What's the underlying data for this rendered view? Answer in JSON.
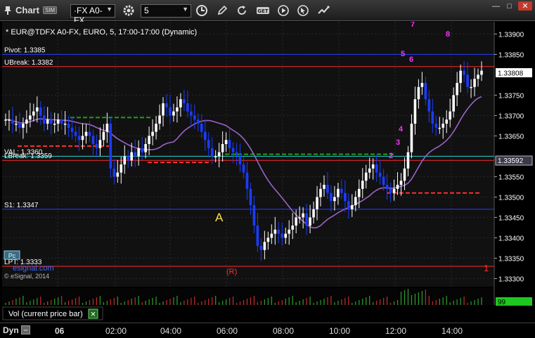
{
  "toolbar": {
    "app_name": "Chart",
    "sim_badge": "SIM",
    "symbol": "·FX A0-FX",
    "interval": "5",
    "icons": [
      "pin-icon",
      "settings-gear-icon",
      "clock-icon",
      "pencil-draw-icon",
      "refresh-icon",
      "get-data-icon",
      "play-icon",
      "cursor-icon",
      "chart-options-icon"
    ]
  },
  "window": {
    "minimize": "—",
    "maximize": "□",
    "close": "✕"
  },
  "chart": {
    "header": "* EUR@TDFX A0-FX, EURO, 5, 17:00-17:00 (Dynamic)",
    "watermark": "© eSignal, 2014",
    "vendor_logo": "esignal.com",
    "indicator_panel_title": "Vol (current price bar)",
    "volume_value": "99",
    "price_axis_labels": [
      "1.33900",
      "1.33850",
      "1.33750",
      "1.33700",
      "1.33650",
      "1.33550",
      "1.33500",
      "1.33450",
      "1.33400",
      "1.33350",
      "1.33300"
    ],
    "current_price": "1.33808",
    "secondary_price_badge": "1.33592",
    "time_labels": [
      "06",
      "02:00",
      "04:00",
      "06:00",
      "08:00",
      "10:00",
      "12:00",
      "14:00"
    ],
    "pattern_marker": "A",
    "reversal_marker": "(R)",
    "level_marker": "1",
    "level_lines": [
      {
        "label": "Pivot: 1.3385",
        "value": 1.3385,
        "color": "#2a3cff"
      },
      {
        "label": "UBreak: 1.3382",
        "value": 1.3382,
        "color": "#ff2a2a"
      },
      {
        "label": "VAL: 1.3360",
        "value": 1.336,
        "color": "#2ad4d4"
      },
      {
        "label": "LBreak: 1.3359",
        "value": 1.3359,
        "color": "#ff2a2a"
      },
      {
        "label": "S1: 1.3347",
        "value": 1.3347,
        "color": "#2a3cff"
      },
      {
        "label": "LPT: 1.3333",
        "value": 1.3333,
        "color": "#ff2a2a"
      }
    ],
    "sequence_labels": [
      "7",
      "8",
      "5",
      "6",
      "4",
      "3",
      "2"
    ],
    "colors": {
      "up_bar": "#ffffff",
      "down_bar": "#1a3cff",
      "ma": "#9a62c8",
      "volume_up": "#2aa02a",
      "volume_down": "#c82a2a",
      "value_badge": "#1ec81e"
    }
  },
  "chart_data": {
    "type": "bar",
    "title": "EUR@TDFX A0-FX, EURO, 5, 17:00-17:00 (Dynamic)",
    "xlabel": "",
    "ylabel": "",
    "x_range": [
      "00:00",
      "15:30"
    ],
    "ylim": [
      1.3328,
      1.3393
    ],
    "grid": true,
    "series": [
      {
        "values": [
          1.3369,
          1.3369,
          1.3368,
          1.3368,
          1.3367,
          1.3368,
          1.3369,
          1.337,
          1.3371,
          1.3372,
          1.337,
          1.3368,
          1.3369,
          1.3368,
          1.3368,
          1.3369,
          1.3368,
          1.3368,
          1.3367,
          1.3366,
          1.3365,
          1.3364,
          1.3365,
          1.3366,
          1.3365,
          1.3363,
          1.3362,
          1.3364,
          1.3366,
          1.3368,
          1.3357,
          1.3355,
          1.3356,
          1.3358,
          1.336,
          1.3359,
          1.3361,
          1.336,
          1.3362,
          1.3361,
          1.3363,
          1.3365,
          1.3366,
          1.3368,
          1.337,
          1.3373,
          1.3372,
          1.337,
          1.3371,
          1.3372,
          1.3374,
          1.3373,
          1.3371,
          1.337,
          1.3369,
          1.3368,
          1.3366,
          1.3364,
          1.3362,
          1.336,
          1.336,
          1.3361,
          1.3363,
          1.3364,
          1.3362,
          1.3361,
          1.336,
          1.3358,
          1.3356,
          1.3352,
          1.3348,
          1.3343,
          1.3338,
          1.3337,
          1.3339,
          1.334,
          1.3341,
          1.3342,
          1.3341,
          1.334,
          1.3341,
          1.3342,
          1.3343,
          1.3345,
          1.3345,
          1.3346,
          1.3343,
          1.3345,
          1.3347,
          1.335,
          1.3352,
          1.3353,
          1.3351,
          1.3349,
          1.335,
          1.3352,
          1.3351,
          1.3349,
          1.3347,
          1.3348,
          1.335,
          1.3352,
          1.3354,
          1.3356,
          1.3357,
          1.3358,
          1.3356,
          1.3355,
          1.3353,
          1.3352,
          1.3351,
          1.3352,
          1.3353,
          1.3354,
          1.3357,
          1.3361,
          1.3368,
          1.3374,
          1.3377,
          1.3378,
          1.3374,
          1.3371,
          1.3368,
          1.3367,
          1.3367,
          1.3368,
          1.3369,
          1.3371,
          1.3375,
          1.3378,
          1.3381,
          1.338,
          1.3377,
          1.3377,
          1.3379,
          1.338,
          1.3381
        ]
      }
    ]
  }
}
